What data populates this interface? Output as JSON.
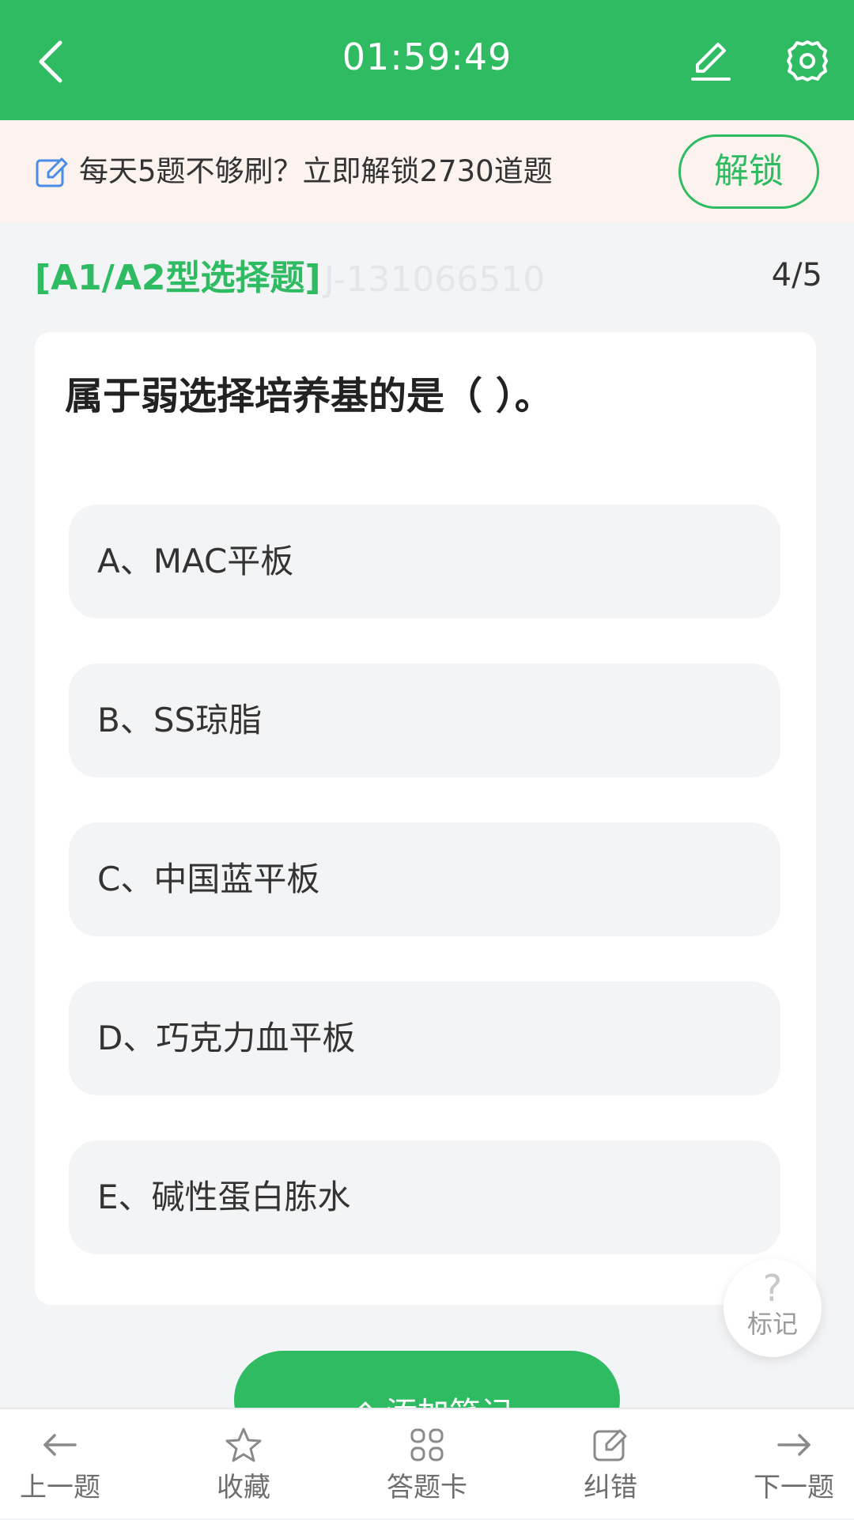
{
  "header": {
    "timer": "01:59:49",
    "back_icon": "chevron-left-icon",
    "edit_icon": "pencil-icon",
    "settings_icon": "gear-icon",
    "background": "#2fbb62"
  },
  "banner": {
    "icon": "edit-note-icon",
    "text": "每天5题不够刷？立即解锁2730道题",
    "button_label": "解锁",
    "background": "#fcf3ef"
  },
  "question_meta": {
    "type_label": "[A1/A2型选择题]",
    "question_id": "J-131066510",
    "progress": "4/5"
  },
  "question": {
    "stem": "属于弱选择培养基的是（ ）。",
    "options": [
      {
        "label": "A、MAC平板"
      },
      {
        "label": "B、SS琼脂"
      },
      {
        "label": "C、中国蓝平板"
      },
      {
        "label": "D、巧克力血平板"
      },
      {
        "label": "E、碱性蛋白胨水"
      }
    ]
  },
  "mark_button": {
    "symbol": "?",
    "label": "标记"
  },
  "note_button": {
    "label": "添加笔记",
    "icon": "pencil-icon"
  },
  "tabbar": {
    "items": [
      {
        "label": "上一题",
        "icon": "arrow-left-icon"
      },
      {
        "label": "收藏",
        "icon": "star-icon"
      },
      {
        "label": "答题卡",
        "icon": "grid-icon"
      },
      {
        "label": "纠错",
        "icon": "edit-icon"
      },
      {
        "label": "下一题",
        "icon": "arrow-right-icon"
      }
    ]
  },
  "colors": {
    "accent": "#2fbb62",
    "page_background": "#f3f4f6",
    "option_background": "#f3f4f6"
  }
}
